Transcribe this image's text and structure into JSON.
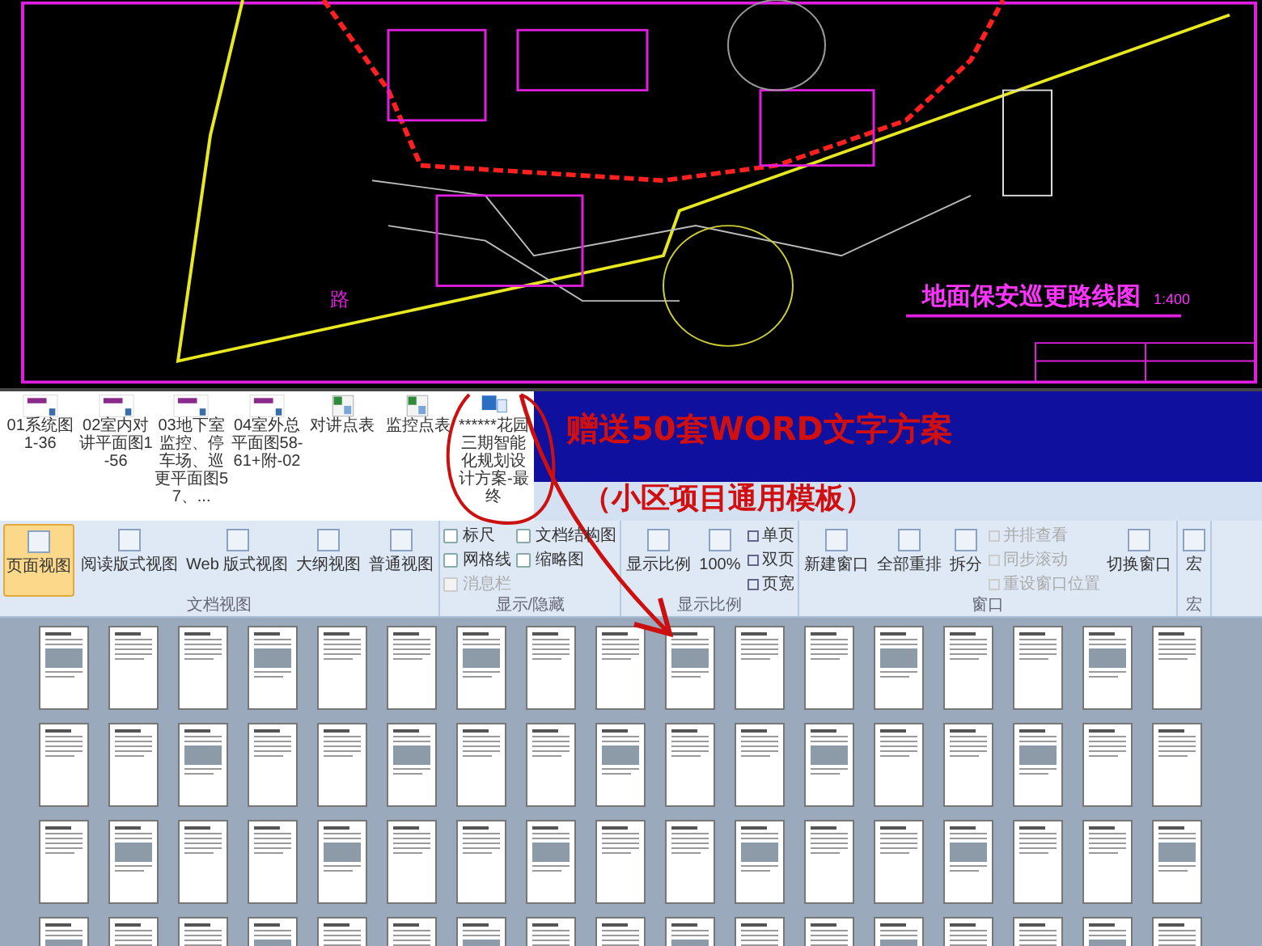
{
  "cad_drawing": {
    "title": "地面保安巡更路线图",
    "scale": "1:400",
    "road_label": "路"
  },
  "files": [
    {
      "name": "01系统图1-36",
      "kind": "drawing"
    },
    {
      "name": "02室内对讲平面图1-56",
      "kind": "drawing"
    },
    {
      "name": "03地下室监控、停车场、巡更平面图57、...",
      "kind": "drawing"
    },
    {
      "name": "04室外总平面图58-61+附-02",
      "kind": "drawing"
    },
    {
      "name": "对讲点表",
      "kind": "spreadsheet"
    },
    {
      "name": "监控点表",
      "kind": "spreadsheet"
    },
    {
      "name": "******花园三期智能化规划设计方案-最终",
      "kind": "document"
    }
  ],
  "banner": {
    "headline": "赠送50套WORD文字方案",
    "subtitle": "（小区项目通用模板）"
  },
  "ribbon": {
    "groups": [
      {
        "label": "文档视图",
        "items": [
          {
            "kind": "large",
            "label": "页面视图",
            "selected": true
          },
          {
            "kind": "large",
            "label": "阅读版式视图",
            "selected": false
          },
          {
            "kind": "large",
            "label": "Web 版式视图",
            "selected": false
          },
          {
            "kind": "large",
            "label": "大纲视图",
            "selected": false
          },
          {
            "kind": "large",
            "label": "普通视图",
            "selected": false
          }
        ]
      },
      {
        "label": "显示/隐藏",
        "items": [
          {
            "kind": "check",
            "label": "标尺",
            "checked": false,
            "disabled": false
          },
          {
            "kind": "check",
            "label": "网格线",
            "checked": false,
            "disabled": false
          },
          {
            "kind": "check",
            "label": "消息栏",
            "checked": false,
            "disabled": true
          },
          {
            "kind": "check",
            "label": "文档结构图",
            "checked": false,
            "disabled": false
          },
          {
            "kind": "check",
            "label": "缩略图",
            "checked": false,
            "disabled": false
          }
        ]
      },
      {
        "label": "显示比例",
        "items": [
          {
            "kind": "large",
            "label": "显示比例"
          },
          {
            "kind": "large",
            "label": "100%"
          },
          {
            "kind": "small",
            "label": "单页",
            "disabled": false
          },
          {
            "kind": "small",
            "label": "双页",
            "disabled": false
          },
          {
            "kind": "small",
            "label": "页宽",
            "disabled": false
          }
        ]
      },
      {
        "label": "窗口",
        "items": [
          {
            "kind": "large",
            "label": "新建窗口"
          },
          {
            "kind": "large",
            "label": "全部重排"
          },
          {
            "kind": "large",
            "label": "拆分"
          },
          {
            "kind": "small",
            "label": "并排查看",
            "disabled": true
          },
          {
            "kind": "small",
            "label": "同步滚动",
            "disabled": true
          },
          {
            "kind": "small",
            "label": "重设窗口位置",
            "disabled": true
          },
          {
            "kind": "large",
            "label": "切换窗口"
          }
        ]
      },
      {
        "label": "宏",
        "items": [
          {
            "kind": "large",
            "label": "宏"
          }
        ]
      }
    ]
  }
}
